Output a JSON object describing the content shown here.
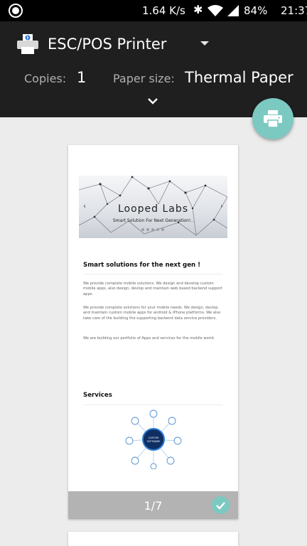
{
  "status_bar": {
    "network_speed": "1.64 K/s",
    "battery": "84%",
    "time": "21:37",
    "icons": [
      "app-indicator-icon",
      "bluetooth-icon",
      "wifi-icon",
      "signal-icon"
    ]
  },
  "header": {
    "printer_name": "ESC/POS Printer",
    "copies_label": "Copies:",
    "copies_value": "1",
    "paper_label": "Paper size:",
    "paper_value": "Thermal Paper"
  },
  "preview": {
    "banner": {
      "title": "Looped  Labs",
      "subtitle": "Smart Solution For Next Generation!.."
    },
    "section_title": "Smart solutions for the next gen !",
    "paragraphs": [
      "We provide complete mobile solutions. We design and develop custom mobile apps, also design, devlop and maintain web based backend support apps.",
      "We provide complete solutions for your mobile needs. We design, devlop and maintain custom mobile apps for android & iPhone platforms. We also take care of the building the supporting backend data service providers.",
      "We are building our portfolio of Apps and services for the mobile world."
    ],
    "services_title": "Services",
    "services_graphic_label": "CUSTOM SOFTWARE",
    "page_count": "1/7"
  },
  "colors": {
    "accent": "#7cc9c2",
    "header_bg": "#1f1f1f",
    "page_bg": "#ececec",
    "footer_bg": "#b3b3b3"
  }
}
